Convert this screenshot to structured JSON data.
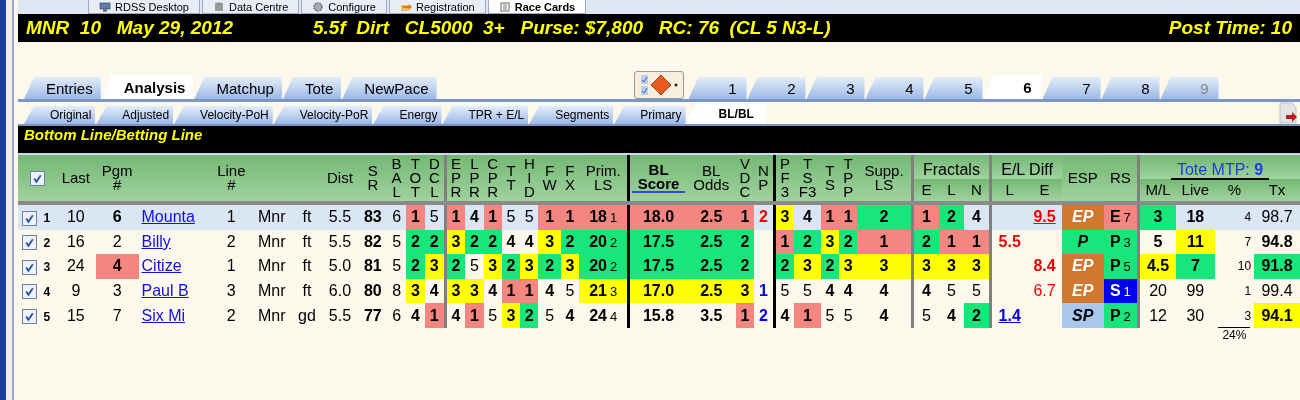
{
  "app_tabs": [
    {
      "label": "RDSS Desktop",
      "selected": false
    },
    {
      "label": "Data Centre",
      "selected": false
    },
    {
      "label": "Configure",
      "selected": false
    },
    {
      "label": "Registration",
      "selected": false
    },
    {
      "label": "Race Cards",
      "selected": true
    }
  ],
  "race_header": {
    "left": "MNR  10   May 29, 2012",
    "middle": "5.5f  Dirt   CL5000  3+   Purse: $7,800   RC: 76  (CL 5 N3-L)",
    "right": "Post Time: 10"
  },
  "view_tabs": [
    {
      "label": "Entries",
      "selected": false
    },
    {
      "label": "Analysis",
      "selected": true
    },
    {
      "label": "Matchup",
      "selected": false
    },
    {
      "label": "Tote",
      "selected": false
    },
    {
      "label": "NewPace",
      "selected": false
    }
  ],
  "race_tabs": [
    {
      "label": "1",
      "selected": false,
      "disabled": false
    },
    {
      "label": "2",
      "selected": false,
      "disabled": false
    },
    {
      "label": "3",
      "selected": false,
      "disabled": false
    },
    {
      "label": "4",
      "selected": false,
      "disabled": false
    },
    {
      "label": "5",
      "selected": false,
      "disabled": false
    },
    {
      "label": "6",
      "selected": true,
      "disabled": false
    },
    {
      "label": "7",
      "selected": false,
      "disabled": false
    },
    {
      "label": "8",
      "selected": false,
      "disabled": false
    },
    {
      "label": "9",
      "selected": false,
      "disabled": true
    }
  ],
  "analysis_tabs": [
    {
      "label": "Original",
      "selected": false
    },
    {
      "label": "Adjusted",
      "selected": false
    },
    {
      "label": "Velocity-PoH",
      "selected": false
    },
    {
      "label": "Velocity-PoR",
      "selected": false
    },
    {
      "label": "Energy",
      "selected": false
    },
    {
      "label": "TPR + E/L",
      "selected": false
    },
    {
      "label": "Segments",
      "selected": false
    },
    {
      "label": "Primary",
      "selected": false
    },
    {
      "label": "BL/BL",
      "selected": true
    }
  ],
  "section_title": "Bottom Line/Betting Line",
  "table": {
    "all_checked": true,
    "header_groups": [
      {
        "colspan": 28
      },
      {
        "label": "Fractals",
        "colspan": 3
      },
      {
        "label": "E/L Diff",
        "colspan": 2
      },
      {
        "colspan": 2
      },
      {
        "label": "Tote MTP: **9**",
        "colspan": 4
      }
    ],
    "columns": [
      {
        "header": [
          "Last"
        ]
      },
      {
        "header": [
          "Pgm",
          "#"
        ]
      },
      {
        "kind": "link"
      },
      {
        "header": [
          "Line",
          "#"
        ]
      },
      {},
      {},
      {
        "header": [
          "Dist"
        ]
      },
      {
        "header": [
          "S",
          "R"
        ]
      },
      {
        "header": [
          "B",
          "A",
          "L"
        ]
      },
      {
        "header": [
          "T",
          "O",
          "T"
        ]
      },
      {
        "header": [
          "D",
          "C",
          "L"
        ]
      },
      {
        "separator": true,
        "heavy": false,
        "header": [
          "E",
          "P",
          "R"
        ]
      },
      {
        "header": [
          "L",
          "P",
          "R"
        ]
      },
      {
        "header": [
          "C",
          "P",
          "R"
        ]
      },
      {
        "header": [
          "T",
          "T"
        ]
      },
      {
        "header": [
          "H",
          "I",
          "D"
        ]
      },
      {
        "header": [
          "F",
          "W"
        ]
      },
      {
        "header": [
          "F",
          "X"
        ]
      },
      {
        "header": [
          "Prim.",
          "LS"
        ]
      },
      {
        "separator": true,
        "heavy": true,
        "header": [
          "BL",
          "Score"
        ],
        "sorted": true
      },
      {
        "header": [
          "BL",
          "Odds"
        ],
        "sorted": false
      },
      {
        "header": [
          "V",
          "D",
          "C"
        ]
      },
      {
        "header": [
          "N",
          "P"
        ]
      },
      {
        "separator": true,
        "heavy": true,
        "header": [
          "P",
          "F",
          "3"
        ]
      },
      {
        "header": [
          "T",
          "S",
          "F3"
        ]
      },
      {
        "header": [
          "T",
          "S"
        ]
      },
      {
        "header": [
          "T",
          "P",
          "P"
        ]
      },
      {
        "header": [
          "Supp.",
          "LS"
        ]
      },
      {
        "separator": true,
        "heavy": false,
        "header": [
          "E"
        ]
      },
      {
        "header": [
          "L"
        ]
      },
      {
        "header": [
          "N"
        ]
      },
      {
        "separator": true,
        "heavy": false,
        "header": [
          "L"
        ]
      },
      {
        "header": [
          "E"
        ]
      },
      {
        "kind": "badge",
        "header": [
          "ESP"
        ]
      },
      {
        "header": [
          "RS"
        ]
      },
      {
        "separator": true,
        "heavy": false,
        "header": [
          "M/L"
        ]
      },
      {
        "header": [
          "Live"
        ]
      },
      {
        "kind": "small",
        "header": [
          "%"
        ],
        "footer": "24%"
      },
      {
        "header": [
          "Tx"
        ]
      }
    ],
    "rows": [
      {
        "number": "1",
        "checked": true,
        "selected": true,
        "cells": [
          "10",
          {
            "text": "6",
            "bold": true
          },
          "Mounta",
          "1",
          "Mnr",
          "ft",
          "5.5",
          {
            "text": "83",
            "bold": true
          },
          "6",
          {
            "text": "1",
            "color": "#f48681"
          },
          "5",
          {
            "text": "1",
            "color": "#f48681"
          },
          {
            "text": "4",
            "bold": true
          },
          {
            "text": "1",
            "color": "#f48681"
          },
          "5",
          "5",
          {
            "text": "1",
            "color": "#f48681"
          },
          {
            "text": "1",
            "color": "#f48681"
          },
          {
            "text": "18",
            "rank": "1",
            "color": "#f48681"
          },
          {
            "text": "18.0",
            "color": "#f48681"
          },
          {
            "text": "2.5",
            "color": "#f48681"
          },
          {
            "text": "1",
            "color": "#f48681"
          },
          {
            "text": "2",
            "alert": true,
            "bold": true
          },
          {
            "text": "3",
            "color": "#ffff00"
          },
          {
            "text": "4",
            "bold": true
          },
          {
            "text": "1",
            "color": "#f48681"
          },
          {
            "text": "1",
            "color": "#f48681"
          },
          {
            "text": "2",
            "color": "#19e67a"
          },
          {
            "text": "1",
            "color": "#f48681"
          },
          {
            "text": "2",
            "color": "#19e67a"
          },
          {
            "text": "4",
            "bold": true
          },
          null,
          {
            "text": "9.5",
            "alert": true,
            "bold": true,
            "link": true
          },
          {
            "text": "EP",
            "color": "#d2772e"
          },
          {
            "text": "E",
            "rank": "7",
            "color": "#f48681"
          },
          {
            "text": "3",
            "color": "#19e67a"
          },
          {
            "text": "18",
            "bold": true
          },
          "4",
          "98.7"
        ]
      },
      {
        "number": "2",
        "checked": true,
        "selected": false,
        "cells": [
          "16",
          "2",
          "Billy",
          "2",
          "Mnr",
          "ft",
          "5.5",
          {
            "text": "82",
            "bold": true
          },
          "5",
          {
            "text": "2",
            "color": "#19e67a"
          },
          {
            "text": "2",
            "color": "#19e67a"
          },
          {
            "text": "3",
            "color": "#ffff00"
          },
          {
            "text": "2",
            "color": "#19e67a"
          },
          {
            "text": "2",
            "color": "#19e67a"
          },
          {
            "text": "4",
            "bold": true
          },
          {
            "text": "4",
            "bold": true
          },
          {
            "text": "3",
            "color": "#ffff00"
          },
          {
            "text": "2",
            "color": "#19e67a"
          },
          {
            "text": "20",
            "rank": "2",
            "color": "#19e67a"
          },
          {
            "text": "17.5",
            "color": "#19e67a"
          },
          {
            "text": "2.5",
            "color": "#19e67a"
          },
          {
            "text": "2",
            "color": "#19e67a"
          },
          null,
          {
            "text": "1",
            "color": "#f48681"
          },
          {
            "text": "2",
            "color": "#19e67a"
          },
          {
            "text": "3",
            "color": "#ffff00"
          },
          {
            "text": "2",
            "color": "#19e67a"
          },
          {
            "text": "1",
            "color": "#f48681"
          },
          {
            "text": "2",
            "color": "#19e67a"
          },
          {
            "text": "1",
            "color": "#f48681"
          },
          {
            "text": "1",
            "color": "#f48681"
          },
          {
            "text": "5.5",
            "alert": true,
            "bold": true
          },
          null,
          {
            "text": "P",
            "color": "#19e67a"
          },
          {
            "text": "P",
            "rank": "3",
            "color": "#19e67a"
          },
          {
            "text": "5",
            "bold": true
          },
          {
            "text": "11",
            "color": "#ffff00"
          },
          "7",
          {
            "text": "94.8",
            "bold": true
          }
        ]
      },
      {
        "number": "3",
        "checked": true,
        "selected": false,
        "cells": [
          "24",
          {
            "text": "4",
            "color": "#f48681"
          },
          "Citize",
          "1",
          "Mnr",
          "ft",
          "5.0",
          {
            "text": "81",
            "bold": true
          },
          "5",
          {
            "text": "2",
            "color": "#19e67a"
          },
          {
            "text": "3",
            "color": "#ffff00"
          },
          {
            "text": "2",
            "color": "#19e67a"
          },
          "5",
          {
            "text": "3",
            "color": "#ffff00"
          },
          {
            "text": "2",
            "color": "#19e67a"
          },
          {
            "text": "3",
            "color": "#ffff00"
          },
          {
            "text": "2",
            "color": "#19e67a"
          },
          {
            "text": "3",
            "color": "#ffff00"
          },
          {
            "text": "20",
            "rank": "2",
            "color": "#19e67a"
          },
          {
            "text": "17.5",
            "color": "#19e67a"
          },
          {
            "text": "2.5",
            "color": "#19e67a"
          },
          {
            "text": "2",
            "color": "#19e67a"
          },
          null,
          {
            "text": "2",
            "color": "#19e67a"
          },
          {
            "text": "3",
            "color": "#ffff00"
          },
          {
            "text": "2",
            "color": "#19e67a"
          },
          {
            "text": "3",
            "color": "#ffff00"
          },
          {
            "text": "3",
            "color": "#ffff00"
          },
          {
            "text": "3",
            "color": "#ffff00"
          },
          {
            "text": "3",
            "color": "#ffff00"
          },
          {
            "text": "3",
            "color": "#ffff00"
          },
          null,
          {
            "text": "8.4",
            "alert": true,
            "bold": true
          },
          {
            "text": "EP",
            "color": "#d2772e"
          },
          {
            "text": "P",
            "rank": "5",
            "color": "#19e67a"
          },
          {
            "text": "4.5",
            "color": "#ffff00"
          },
          {
            "text": "7",
            "color": "#19e67a"
          },
          "10",
          {
            "text": "91.8",
            "color": "#19e67a"
          }
        ]
      },
      {
        "number": "4",
        "checked": true,
        "selected": false,
        "cells": [
          "9",
          "3",
          "Paul B",
          "3",
          "Mnr",
          "ft",
          "6.0",
          {
            "text": "80",
            "bold": true
          },
          "8",
          {
            "text": "3",
            "color": "#ffff00"
          },
          {
            "text": "4",
            "bold": true
          },
          {
            "text": "3",
            "color": "#ffff00"
          },
          {
            "text": "3",
            "color": "#ffff00"
          },
          {
            "text": "4",
            "bold": true
          },
          {
            "text": "1",
            "color": "#f48681"
          },
          {
            "text": "1",
            "color": "#f48681"
          },
          {
            "text": "4",
            "bold": true
          },
          "5",
          {
            "text": "21",
            "rank": "3",
            "color": "#ffff00"
          },
          {
            "text": "17.0",
            "color": "#ffff00"
          },
          {
            "text": "2.5",
            "color": "#ffff00"
          },
          {
            "text": "3",
            "color": "#ffff00"
          },
          {
            "text": "1",
            "info": true,
            "bold": true
          },
          "5",
          "5",
          {
            "text": "4",
            "bold": true
          },
          {
            "text": "4",
            "bold": true
          },
          {
            "text": "4",
            "bold": true
          },
          {
            "text": "4",
            "bold": true
          },
          "5",
          "5",
          null,
          {
            "text": "6.7",
            "alert": true
          },
          {
            "text": "EP",
            "color": "#d2772e"
          },
          {
            "text": "S",
            "rank": "1",
            "color": "#0000ee"
          },
          "20",
          "99",
          "1",
          "99.4"
        ]
      },
      {
        "number": "5",
        "checked": true,
        "selected": false,
        "cells": [
          "15",
          "7",
          "Six Mi",
          "2",
          "Mnr",
          "gd",
          "5.5",
          {
            "text": "77",
            "bold": true
          },
          "6",
          {
            "text": "4",
            "bold": true
          },
          {
            "text": "1",
            "color": "#f48681"
          },
          {
            "text": "4",
            "bold": true
          },
          {
            "text": "1",
            "color": "#f48681"
          },
          "5",
          {
            "text": "3",
            "color": "#ffff00"
          },
          {
            "text": "2",
            "color": "#19e67a"
          },
          "5",
          {
            "text": "4",
            "bold": true
          },
          {
            "text": "24",
            "rank": "4",
            "bold": true
          },
          {
            "text": "15.8",
            "bold": true
          },
          {
            "text": "3.5",
            "bold": true
          },
          {
            "text": "1",
            "color": "#f48681"
          },
          {
            "text": "2",
            "info": true,
            "bold": true
          },
          {
            "text": "4",
            "bold": true
          },
          {
            "text": "1",
            "color": "#f48681"
          },
          "5",
          "5",
          {
            "text": "4",
            "bold": true
          },
          "5",
          {
            "text": "4",
            "bold": true
          },
          {
            "text": "2",
            "color": "#19e67a"
          },
          {
            "text": "1.4",
            "info": true,
            "bold": true,
            "link": true
          },
          null,
          {
            "text": "SP",
            "color": "#a8c8ee"
          },
          {
            "text": "P",
            "rank": "2",
            "color": "#19e67a"
          },
          "12",
          "30",
          "3",
          {
            "text": "94.1",
            "color": "#ffff00"
          }
        ]
      }
    ]
  }
}
